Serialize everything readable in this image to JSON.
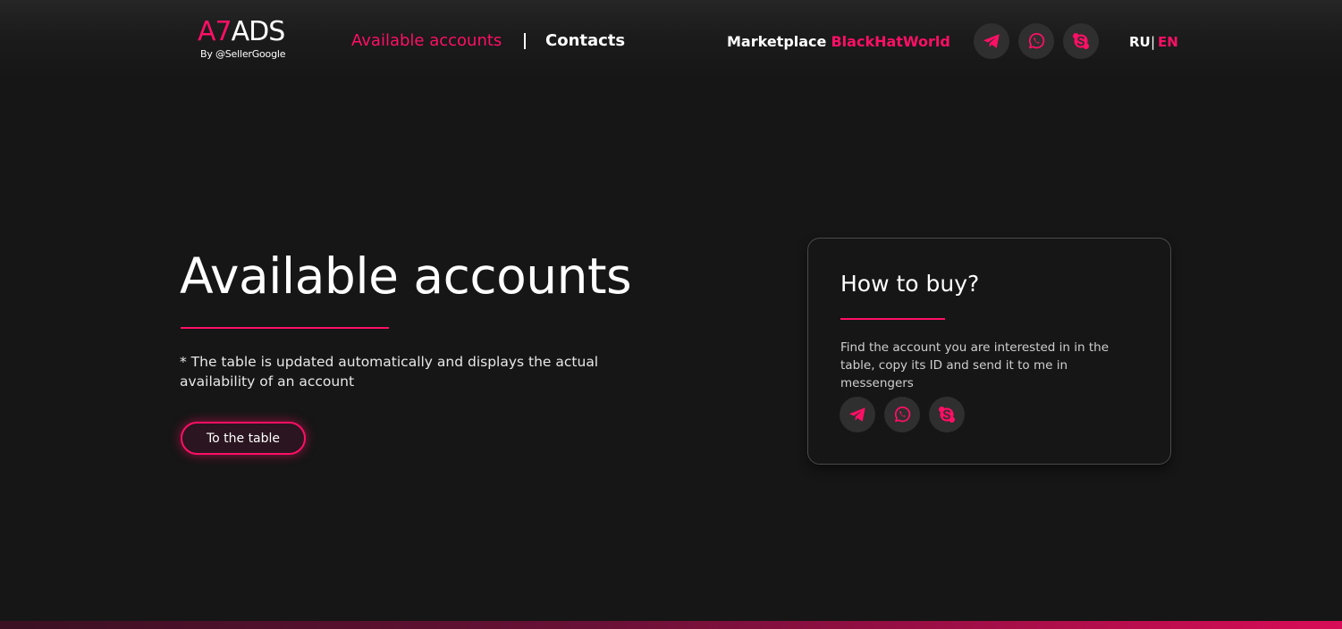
{
  "brand": {
    "logo_accent": "A7",
    "logo_main": "ADS",
    "tagline": "By @SellerGoogle"
  },
  "nav": {
    "available_accounts": "Available accounts",
    "separator": "|",
    "contacts": "Contacts"
  },
  "marketplace": {
    "label": "Marketplace",
    "link": "BlackHatWorld"
  },
  "messengers": [
    "telegram-icon",
    "whatsapp-icon",
    "skype-icon"
  ],
  "language": {
    "ru": "RU",
    "separator": "|",
    "en": "EN",
    "active": "EN"
  },
  "hero": {
    "title": "Available accounts",
    "note": "* The table is updated automatically and displays the actual availability of an account",
    "button_label": "To the table"
  },
  "how_to_buy": {
    "title": "How to buy?",
    "text": "Find the account you are interested in in the table, copy its ID and send it to me in messengers"
  },
  "colors": {
    "accent": "#ff0f65",
    "background": "#161616",
    "icon_bg": "#2f2f2f",
    "text": "#ffffff"
  }
}
